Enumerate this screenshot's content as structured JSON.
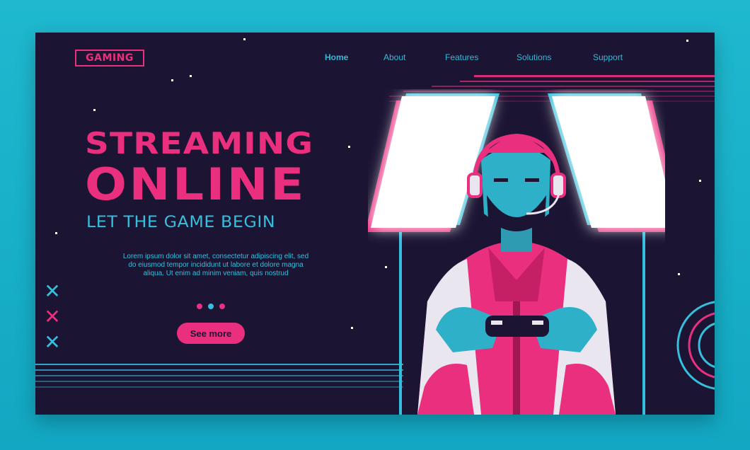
{
  "brand": {
    "logo_text": "GAMING"
  },
  "nav": [
    {
      "label": "Home",
      "active": true
    },
    {
      "label": "About",
      "active": false
    },
    {
      "label": "Features",
      "active": false
    },
    {
      "label": "Solutions",
      "active": false
    },
    {
      "label": "Support",
      "active": false
    }
  ],
  "hero": {
    "title_line1": "STREAMING",
    "title_line2": "ONLINE",
    "subtitle": "LET THE GAME BEGIN",
    "description": "Lorem ipsum dolor sit amet, consectetur adipiscing elit, sed do eiusmod tempor incididunt ut labore et dolore magna aliqua. Ut enim ad minim veniam, quis nostrud",
    "cta_label": "See more"
  },
  "carousel": {
    "dot_colors": [
      "#ea2f7f",
      "#35bfdc",
      "#ea2f7f"
    ]
  },
  "decor": {
    "cross_colors": [
      "#35bfdc",
      "#ea2f7f",
      "#35bfdc"
    ],
    "cross_icon": "cross-icon"
  },
  "colors": {
    "page_background": "#1fb8cf",
    "card_background": "#1c1433",
    "accent_pink": "#ea2f7f",
    "accent_cyan": "#35bfdc"
  }
}
